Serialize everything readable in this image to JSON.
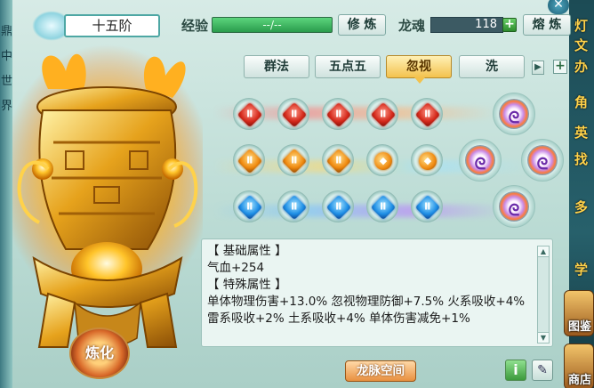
{
  "header": {
    "level": "十五阶",
    "exp_label": "经验",
    "exp_value": "--/--",
    "train_button": "修 炼",
    "soul_label": "龙魂",
    "soul_value": "118",
    "smelt_button": "熔 炼"
  },
  "tabs": [
    {
      "label": "群法",
      "active": false
    },
    {
      "label": "五点五",
      "active": false
    },
    {
      "label": "忽视",
      "active": true
    },
    {
      "label": "洗",
      "active": false
    }
  ],
  "gems": {
    "rows": [
      [
        "red",
        "red",
        "red",
        "red",
        "red"
      ],
      [
        "orange",
        "orange",
        "orange",
        "orange-round",
        "orange-round"
      ],
      [
        "blue",
        "blue",
        "blue",
        "blue",
        "blue"
      ]
    ],
    "core_slots": 4
  },
  "info": {
    "base_header": "【 基础属性 】",
    "base_line": "气血+254",
    "special_header": "【 特殊属性 】",
    "special_line1": "单体物理伤害+13.0%  忽视物理防御+7.5%  火系吸收+4%",
    "special_line2": "雷系吸收+2%  土系吸收+4%  单体伤害减免+1%"
  },
  "bottom": {
    "dragon_space_button": "龙脉空间",
    "refine_button": "炼化"
  },
  "left_strip": [
    "鼎",
    "中",
    "世",
    "界"
  ],
  "right_strip": [
    "灯",
    "文",
    "办",
    "角",
    "英",
    "找",
    "多",
    "学"
  ],
  "right_buttons": [
    "图鉴",
    "商店"
  ],
  "colors": {
    "accent": "#4ea7a4",
    "active_tab": "#f3c24e",
    "exp_bar": "#2a9c4c"
  }
}
